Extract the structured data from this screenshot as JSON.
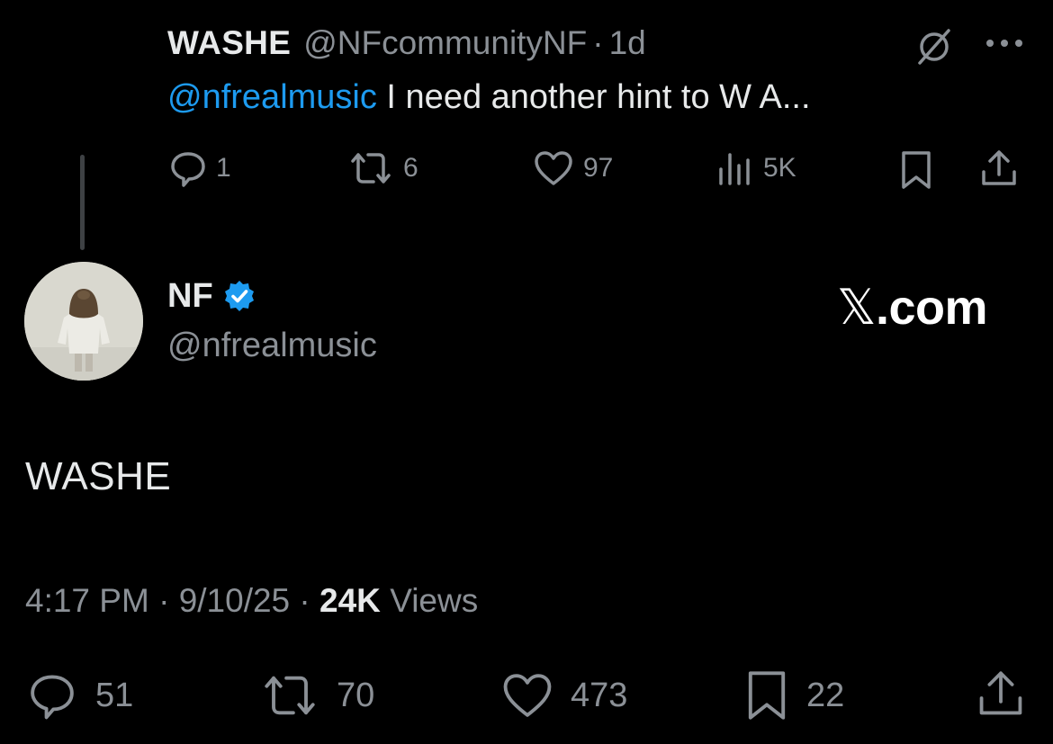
{
  "parent_tweet": {
    "display_name": "WASHE",
    "handle": "@NFcommunityNF",
    "separator": "·",
    "time": "1d",
    "mention": "@nfrealmusic",
    "text": " I need another hint to W A...",
    "stats": {
      "replies": "1",
      "reposts": "6",
      "likes": "97",
      "views": "5K"
    }
  },
  "main_tweet": {
    "display_name": "NF",
    "handle": "@nfrealmusic",
    "watermark_x": "𝕏",
    "watermark_suffix": ".com",
    "text": "WASHE",
    "time": "4:17 PM",
    "separator": "·",
    "date": "9/10/25",
    "views_count": "24K",
    "views_label": "Views",
    "stats": {
      "replies": "51",
      "reposts": "70",
      "likes": "473",
      "bookmarks": "22"
    }
  },
  "colors": {
    "background": "#000000",
    "text": "#e7e9ea",
    "muted": "#8b9096",
    "link": "#1d9bf0",
    "verified": "#1d9bf0"
  },
  "icons": {
    "reply": "reply-icon",
    "repost": "repost-icon",
    "like": "heart-icon",
    "views": "views-icon",
    "bookmark": "bookmark-icon",
    "share": "share-icon",
    "grok": "grok-icon",
    "more": "more-icon",
    "verified": "verified-badge-icon"
  }
}
